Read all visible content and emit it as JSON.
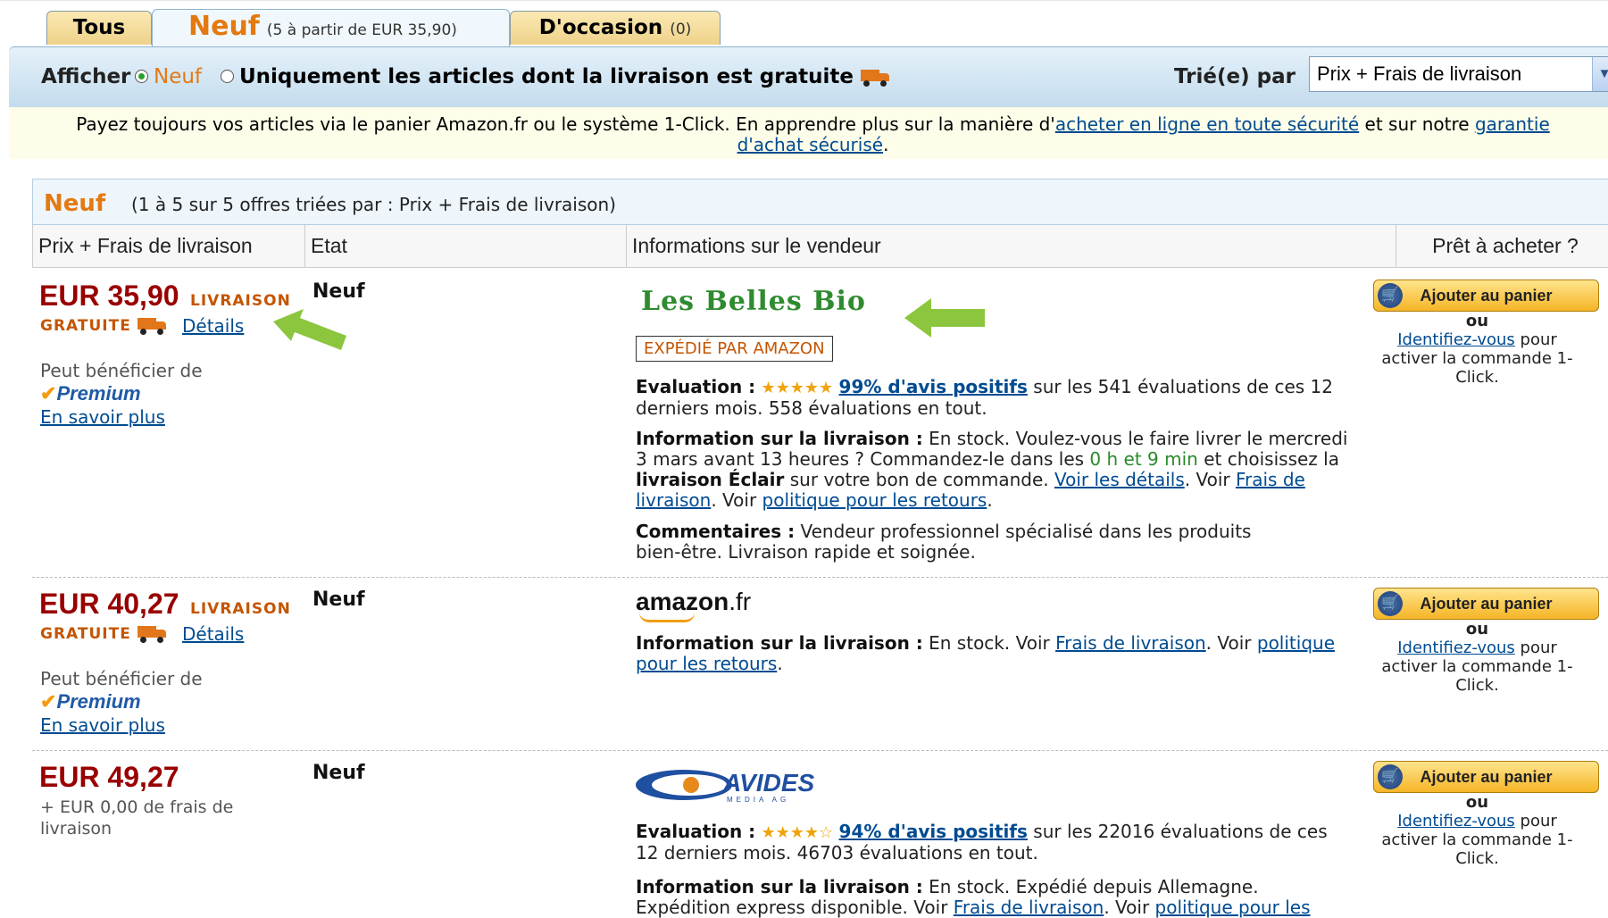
{
  "tabs": {
    "tous": "Tous",
    "neuf_title": "Neuf",
    "neuf_sub": "(5 à partir de EUR 35,90)",
    "occasion_title": "D'occasion",
    "occasion_sub": "(0)"
  },
  "filter": {
    "afficher": "Afficher",
    "opt_neuf": "Neuf",
    "opt_gratuite": "Uniquement les articles dont la livraison est gratuite",
    "trie_par": "Trié(e) par",
    "sort_value": "Prix + Frais de livraison"
  },
  "info": {
    "text1": "Payez toujours vos articles via le panier Amazon.fr ou le système 1-Click. En apprendre plus sur la manière d'",
    "link1": "acheter en ligne en toute sécurité",
    "text2": " et sur notre ",
    "link2": "garantie d'achat sécurisé",
    "text3": "."
  },
  "listing": {
    "title": "Neuf",
    "subtitle": "(1 à 5 sur 5 offres triées par : Prix + Frais de livraison)",
    "columns": [
      "Prix + Frais de livraison",
      "Etat",
      "Informations sur le vendeur",
      "Prêt à acheter ?"
    ]
  },
  "offers": [
    {
      "price": "EUR 35,90",
      "livraison": "LIVRAISON",
      "gratuite": "GRATUITE",
      "details": "Détails",
      "premium_intro": "Peut bénéficier de",
      "premium": "Premium",
      "en_savoir": "En savoir plus",
      "etat": "Neuf",
      "seller": "Les Belles Bio",
      "expedie": "EXPÉDIÉ PAR AMAZON",
      "eval_label": "Evaluation :",
      "stars": "★★★★★",
      "eval_link": "99% d'avis positifs",
      "eval_text": " sur les 541 évaluations de ces 12 derniers mois. 558 évaluations en tout.",
      "ship_label": "Information sur la livraison :",
      "ship_text1": " En stock. Voulez-vous le faire livrer le mercredi 3 mars avant 13 heures ? Commandez-le dans les ",
      "ship_time": "0 h et 9 min",
      "ship_text2": "  et choisissez la ",
      "ship_eclair": "livraison Éclair",
      "ship_text3": " sur votre bon de commande. ",
      "ship_link1": "Voir les détails",
      "ship_text4": ". Voir ",
      "ship_link2": "Frais de livraison",
      "ship_text5": ". Voir ",
      "ship_link3": "politique pour les retours",
      "ship_text6": ".",
      "comm_label": "Commentaires :",
      "comm_text": "   Vendeur professionnel spécialisé dans les produits bien-être. Livraison rapide et soignée.",
      "cart": "Ajouter au panier",
      "ou": "ou",
      "ident": "Identifiez-vous",
      "ident_text": " pour activer la commande 1-Click."
    },
    {
      "price": "EUR 40,27",
      "livraison": "LIVRAISON",
      "gratuite": "GRATUITE",
      "details": "Détails",
      "premium_intro": "Peut bénéficier de",
      "premium": "Premium",
      "en_savoir": "En savoir plus",
      "etat": "Neuf",
      "seller_logo": "amazon",
      "seller_logo_fr": ".fr",
      "ship_label": "Information sur la livraison :",
      "ship_text1": " En stock. Voir ",
      "ship_link1": "Frais de livraison",
      "ship_text2": ". Voir ",
      "ship_link2": "politique pour les retours",
      "ship_text3": ".",
      "cart": "Ajouter au panier",
      "ou": "ou",
      "ident": "Identifiez-vous",
      "ident_text": " pour activer la commande 1-Click."
    },
    {
      "price": "EUR 49,27",
      "frais": "+ EUR 0,00 de frais de livraison",
      "etat": "Neuf",
      "seller_logo": "AVIDES",
      "seller_logo_sub": "MEDIA AG",
      "eval_label": "Evaluation :",
      "stars": "★★★★☆",
      "eval_link": "94% d'avis positifs",
      "eval_text": " sur les 22016 évaluations de ces 12 derniers mois. 46703 évaluations en tout.",
      "ship_label": "Information sur la livraison :",
      "ship_text1": " En stock. Expédié depuis Allemagne. Expédition express disponible. Voir ",
      "ship_link1": "Frais de livraison",
      "ship_text2": ". Voir ",
      "ship_link2": "politique pour les",
      "cart": "Ajouter au panier",
      "ou": "ou",
      "ident": "Identifiez-vous",
      "ident_text": " pour activer la commande 1-Click."
    }
  ],
  "colors": {
    "orange": "#e47911",
    "price_red": "#990000",
    "link_blue": "#004b91",
    "arrow_green": "#8cc63f"
  }
}
